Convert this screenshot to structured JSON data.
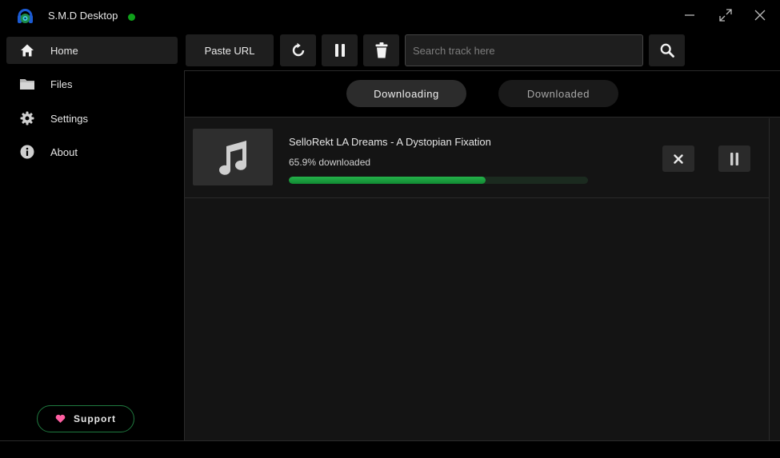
{
  "window": {
    "title": "S.M.D Desktop",
    "status_color": "#0fa01a",
    "controls": [
      "minimize-icon",
      "maximize-icon",
      "close-icon"
    ]
  },
  "sidebar": {
    "items": [
      {
        "label": "Home",
        "icon": "home-icon",
        "active": true
      },
      {
        "label": "Files",
        "icon": "folder-icon",
        "active": false
      },
      {
        "label": "Settings",
        "icon": "gear-icon",
        "active": false
      },
      {
        "label": "About",
        "icon": "info-icon",
        "active": false
      }
    ],
    "support_label": "Support"
  },
  "toolbar": {
    "paste_label": "Paste URL",
    "search_placeholder": "Search track here",
    "search_value": ""
  },
  "tabs": [
    {
      "label": "Downloading",
      "active": true
    },
    {
      "label": "Downloaded",
      "active": false
    }
  ],
  "downloads": [
    {
      "title": "SelloRekt LA Dreams - A Dystopian Fixation",
      "status": "65.9% downloaded",
      "progress": 0.659
    }
  ],
  "colors": {
    "accent": "#1fa347",
    "support_border": "#1f7a3f",
    "heart": "#ff5fa2"
  }
}
